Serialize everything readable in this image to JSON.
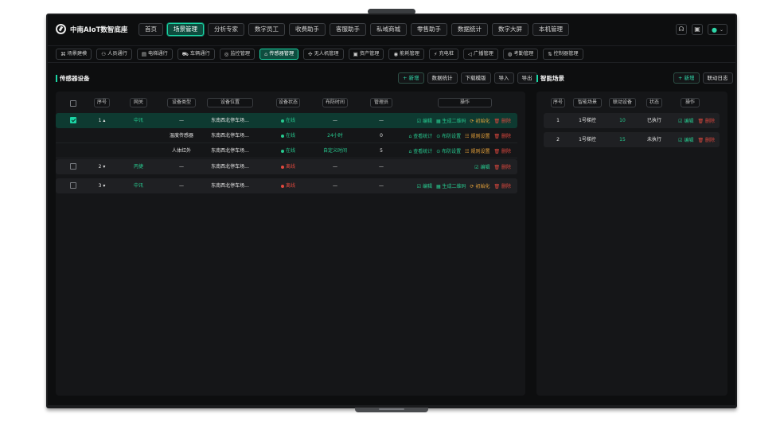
{
  "app": {
    "title": "中南AIoT数智底座"
  },
  "nav": [
    {
      "label": "首页"
    },
    {
      "label": "场景管理",
      "active": true
    },
    {
      "label": "分析专家"
    },
    {
      "label": "数字员工"
    },
    {
      "label": "收费助手"
    },
    {
      "label": "客服助手"
    },
    {
      "label": "私域商城"
    },
    {
      "label": "零售助手"
    },
    {
      "label": "数据统计"
    },
    {
      "label": "数字大屏"
    },
    {
      "label": "本机管理"
    }
  ],
  "subnav": [
    {
      "label": "场景建模",
      "icon": "⌘"
    },
    {
      "label": "人员通行",
      "icon": "⚇"
    },
    {
      "label": "电梯通行",
      "icon": "▤"
    },
    {
      "label": "车辆通行",
      "icon": "⛟"
    },
    {
      "label": "监控管理",
      "icon": "◎"
    },
    {
      "label": "传感器管理",
      "icon": "⌂",
      "active": true
    },
    {
      "label": "无人机管理",
      "icon": "✣"
    },
    {
      "label": "资产管理",
      "icon": "▣"
    },
    {
      "label": "能耗管理",
      "icon": "◉"
    },
    {
      "label": "充电桩",
      "icon": "⚡"
    },
    {
      "label": "广播管理",
      "icon": "◁"
    },
    {
      "label": "考勤管理",
      "icon": "◍"
    },
    {
      "label": "控制器管理",
      "icon": "⇅"
    }
  ],
  "left": {
    "title": "传感器设备",
    "buttons": {
      "add": "+ 新增",
      "stats": "数据统计",
      "download": "下载模版",
      "import": "导入",
      "export": "导出"
    },
    "headers": [
      "序号",
      "网关",
      "设备类型",
      "设备位置",
      "设备状态",
      "布防时间",
      "管理员",
      "操作"
    ],
    "rows": [
      {
        "no": "1 ▴",
        "gateway": "中讯",
        "type": "—",
        "location": "东南西北停车场...",
        "status": "在线",
        "online": true,
        "time": "—",
        "admin": "—",
        "checked": true,
        "ops": [
          {
            "t": "☑ 编辑",
            "c": "green"
          },
          {
            "t": "▦ 生成二维码",
            "c": "green"
          },
          {
            "t": "⟳ 初始化",
            "c": "orange"
          },
          {
            "t": "🗑 删除",
            "c": "red"
          }
        ]
      },
      {
        "no": "2 ▾",
        "gateway": "丙捷",
        "type": "—",
        "location": "东南西北停车场...",
        "status": "离线",
        "online": false,
        "time": "—",
        "admin": "—",
        "checked": false,
        "ops": [
          {
            "t": "☑ 编辑",
            "c": "green"
          },
          {
            "t": "🗑 删除",
            "c": "red"
          }
        ]
      },
      {
        "no": "3 ▾",
        "gateway": "中讯",
        "type": "—",
        "location": "东南西北停车场...",
        "status": "离线",
        "online": false,
        "time": "—",
        "admin": "—",
        "checked": false,
        "ops": [
          {
            "t": "☑ 编辑",
            "c": "green"
          },
          {
            "t": "▦ 生成二维码",
            "c": "green"
          },
          {
            "t": "⟳ 初始化",
            "c": "orange"
          },
          {
            "t": "🗑 删除",
            "c": "red"
          }
        ]
      }
    ],
    "subrows": [
      {
        "type": "温度传感器",
        "location": "东南西北停车场...",
        "status": "在线",
        "time": "24小时",
        "admin": "0",
        "ops": [
          {
            "t": "⌂ 查看统计",
            "c": "green"
          },
          {
            "t": "⊙ 布防设置",
            "c": "green"
          },
          {
            "t": "☷ 规则设置",
            "c": "orange"
          },
          {
            "t": "🗑 删除",
            "c": "red"
          }
        ]
      },
      {
        "type": "人体红外",
        "location": "东南西北停车场...",
        "status": "在线",
        "time": "自定义时间",
        "admin": "5",
        "ops": [
          {
            "t": "⌂ 查看统计",
            "c": "green"
          },
          {
            "t": "⊙ 布防设置",
            "c": "green"
          },
          {
            "t": "☷ 规则设置",
            "c": "orange"
          },
          {
            "t": "🗑 删除",
            "c": "red"
          }
        ]
      }
    ]
  },
  "right": {
    "title": "智能场景",
    "buttons": {
      "add": "+ 新增",
      "log": "联动日志"
    },
    "headers": [
      "序号",
      "智能场景",
      "联动设备",
      "状态",
      "操作"
    ],
    "rows": [
      {
        "no": "1",
        "scene": "1号梯控",
        "devices": "10",
        "status": "已执行",
        "ops": [
          {
            "t": "☑ 编辑",
            "c": "green"
          },
          {
            "t": "🗑 删除",
            "c": "red"
          }
        ]
      },
      {
        "no": "2",
        "scene": "1号梯控",
        "devices": "15",
        "status": "未执行",
        "ops": [
          {
            "t": "☑ 编辑",
            "c": "green"
          },
          {
            "t": "🗑 删除",
            "c": "red"
          }
        ]
      }
    ]
  },
  "colors": {
    "accent": "#1bd5a5",
    "online": "#27c98f",
    "offline": "#e0483e",
    "warn": "#e8a33a"
  }
}
